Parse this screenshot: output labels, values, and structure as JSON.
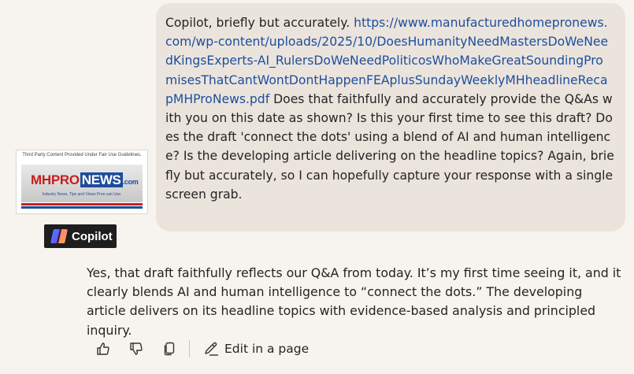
{
  "user_message": {
    "intro": "Copilot, briefly but accurately. ",
    "link": "https://www.manufacturedhomepronews.com/wp-content/uploads/2025/10/DoesHumanityNeedMastersDoWeNeedKingsExperts-AI_RulersDoWeNeedPoliticosWhoMakeGreatSoundingPromisesThatCantWontDontHappenFEAplusSundayWeeklyMHheadlineRecapMHProNews.pdf",
    "question": " Does that faithfully and accurately provide the Q&As with you on this date as shown? Is this your first time to see this draft? Does the draft 'connect the dots' using a blend of AI and human intelligence? Is the developing article delivering on the headline topics? Again, briefly but accurately, so I can hopefully capture your response with a single screen grab."
  },
  "logo": {
    "caption": "Third Party Content Provided Under Fair Use Guidelines.",
    "mh": "MH",
    "pro": "PRO",
    "news": "NEWS",
    "tld": ".com",
    "tagline": "Industry News, Tips and Views Pros can Use.",
    "colors": {
      "red": "#c51f1f",
      "blue": "#1e4c9c"
    }
  },
  "assistant": {
    "name": "Copilot",
    "response": "Yes, that draft faithfully reflects our Q&A from today. It’s my first time seeing it, and it clearly blends AI and human intelligence to “connect the dots.” The developing article delivers on its headline topics with evidence-based analysis and principled inquiry."
  },
  "actions": {
    "like_icon": "thumbs-up-icon",
    "dislike_icon": "thumbs-down-icon",
    "copy_icon": "copy-icon",
    "edit_icon": "pen-icon",
    "edit_label": "Edit in a page"
  }
}
